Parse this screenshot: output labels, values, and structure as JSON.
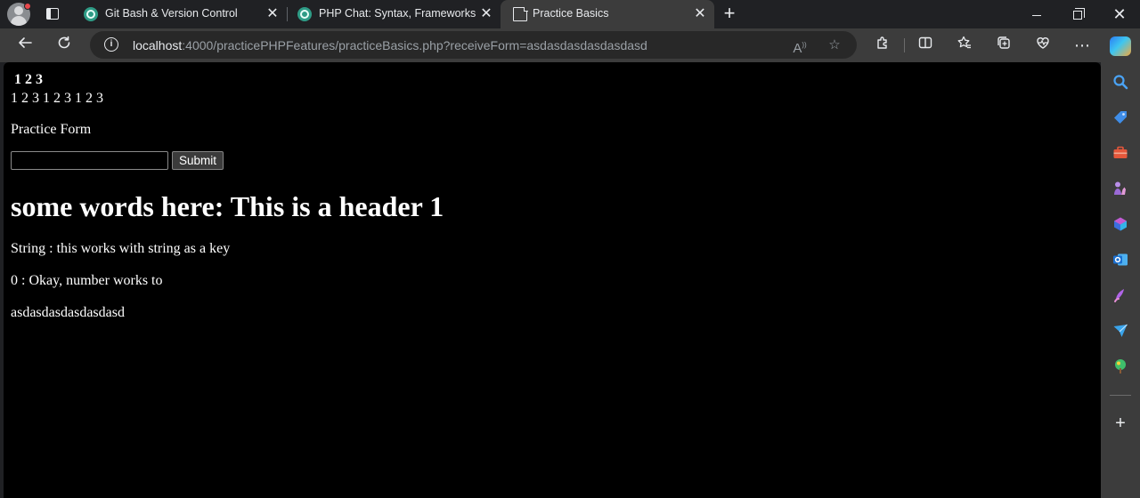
{
  "browser": {
    "tabs": [
      {
        "title": "Git Bash & Version Control",
        "icon": "chatgpt-icon"
      },
      {
        "title": "PHP Chat: Syntax, Frameworks",
        "icon": "chatgpt-icon"
      },
      {
        "title": "Practice Basics",
        "icon": "document-icon",
        "active": true
      }
    ],
    "address": {
      "host": "localhost",
      "rest": ":4000/practicePHPFeatures/practiceBasics.php?receiveForm=asdasdasdasdasdasd"
    },
    "accent_color": "#3c3c3c"
  },
  "page": {
    "bold_line": "1 2 3",
    "plain_line": "1 2 3 1 2 3 1 2 3",
    "form_label": "Practice Form",
    "input_value": "",
    "submit_label": "Submit",
    "heading": "some words here: This is a header 1",
    "paragraphs": [
      "String : this works with string as a key",
      "0 : Okay, number works to",
      "asdasdasdasdasdasd"
    ]
  }
}
